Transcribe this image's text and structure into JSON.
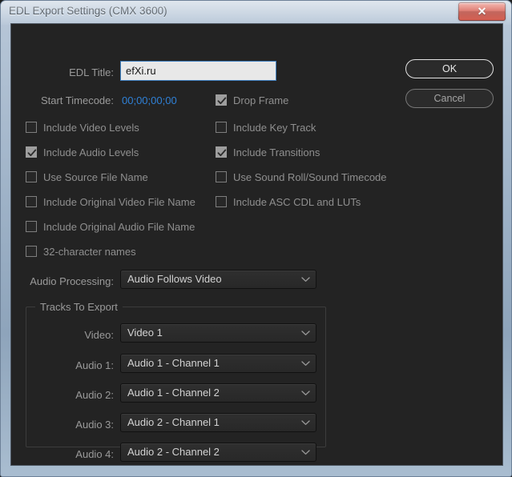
{
  "window": {
    "title": "EDL Export Settings (CMX 3600)",
    "close_glyph": "✕",
    "accent_blue": "#2f80d6",
    "close_red": "#cf3b2c",
    "client_bg": "#232323"
  },
  "form": {
    "edl_title_label": "EDL Title:",
    "edl_title_value": "efXi.ru",
    "edl_title_placeholder": "EDL Title",
    "start_timecode_label": "Start Timecode:",
    "start_timecode_value": "00;00;00;00",
    "audio_processing_label": "Audio Processing:",
    "audio_processing_value": "Audio Follows Video"
  },
  "buttons": {
    "ok": "OK",
    "cancel": "Cancel"
  },
  "checkboxes": {
    "drop_frame": {
      "label": "Drop Frame",
      "checked": true
    },
    "left_column": [
      {
        "label": "Include Video Levels",
        "checked": false
      },
      {
        "label": "Include Audio Levels",
        "checked": true
      },
      {
        "label": "Use Source File Name",
        "checked": false
      },
      {
        "label": "Include Original Video File Name",
        "checked": false
      },
      {
        "label": "Include Original Audio File Name",
        "checked": false
      },
      {
        "label": "32-character names",
        "checked": false
      }
    ],
    "right_column": [
      {
        "label": "Include Key Track",
        "checked": false
      },
      {
        "label": "Include Transitions",
        "checked": true
      },
      {
        "label": "Use Sound Roll/Sound Timecode",
        "checked": false
      },
      {
        "label": "Include ASC CDL and LUTs",
        "checked": false
      }
    ]
  },
  "tracks_group": {
    "title": "Tracks To Export",
    "rows": [
      {
        "label": "Video:",
        "value": "Video 1"
      },
      {
        "label": "Audio 1:",
        "value": "Audio 1 - Channel 1"
      },
      {
        "label": "Audio 2:",
        "value": "Audio 1 - Channel 2"
      },
      {
        "label": "Audio 3:",
        "value": "Audio 2 - Channel 1"
      },
      {
        "label": "Audio 4:",
        "value": "Audio 2 - Channel 2"
      }
    ]
  },
  "icons": {
    "close": "close-icon",
    "checkmark": "check-icon",
    "chevron_down": "chevron-down-icon"
  }
}
